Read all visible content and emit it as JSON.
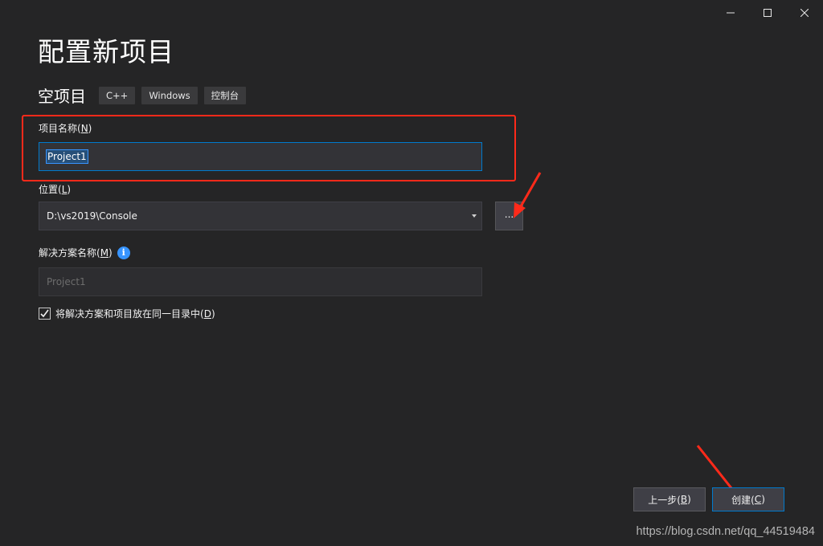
{
  "window": {
    "title": "配置新项目",
    "caption": {
      "minimize": "—",
      "maximize": "☐",
      "close": "✕"
    }
  },
  "template": {
    "name": "空项目",
    "tags": [
      "C++",
      "Windows",
      "控制台"
    ]
  },
  "form": {
    "project_name": {
      "label": "项目名称(",
      "hotkey": "N",
      "label_end": ")",
      "value": "Project1"
    },
    "location": {
      "label": "位置(",
      "hotkey": "L",
      "label_end": ")",
      "value": "D:\\vs2019\\Console",
      "browse_label": "..."
    },
    "solution_name": {
      "label": "解决方案名称(",
      "hotkey": "M",
      "label_end": ")",
      "placeholder": "Project1",
      "info_icon": "i"
    },
    "same_dir": {
      "checked": true,
      "label": "将解决方案和项目放在同一目录中(",
      "hotkey": "D",
      "label_end": ")"
    }
  },
  "buttons": {
    "back": {
      "label": "上一步(",
      "hotkey": "B",
      "label_end": ")"
    },
    "create": {
      "label": "创建(",
      "hotkey": "C",
      "label_end": ")"
    }
  },
  "watermark": "https://blog.csdn.net/qq_44519484",
  "colors": {
    "accent": "#007acc",
    "annotation": "#ff2a1a",
    "background": "#252526"
  }
}
